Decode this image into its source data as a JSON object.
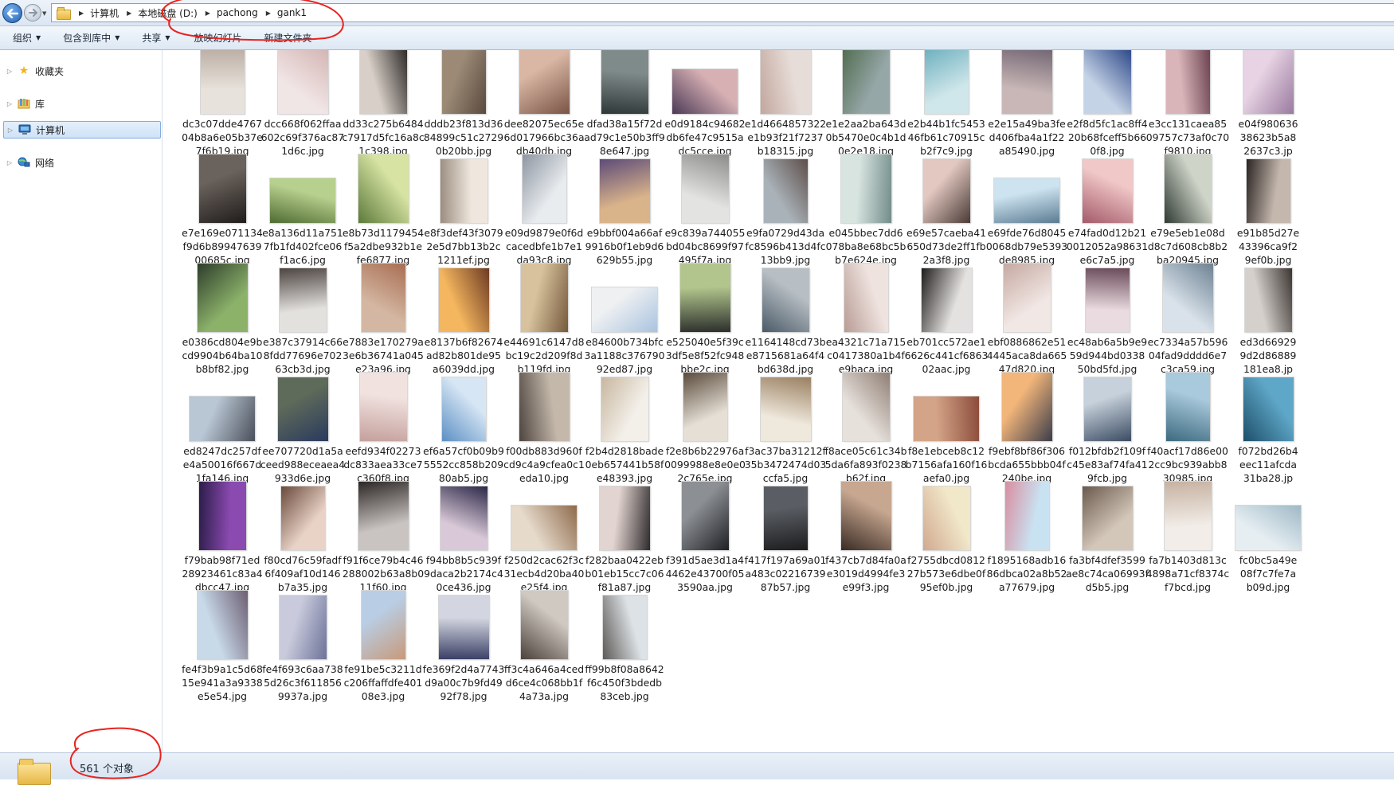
{
  "address_bar": {
    "crumbs": [
      "计算机",
      "本地磁盘 (D:)",
      "pachong",
      "gank1"
    ]
  },
  "toolbar": {
    "organize": "组织",
    "include_in_library": "包含到库中",
    "share": "共享",
    "slideshow": "放映幻灯片",
    "new_folder": "新建文件夹"
  },
  "nav": {
    "favorites": "收藏夹",
    "libraries": "库",
    "computer": "计算机",
    "network": "网络"
  },
  "files": [
    {
      "name": "dc3c07dde4767\n04b8a6e05b37e\n7f6b19.jpg",
      "bg": [
        "#e8e2dc",
        "#b8aaa0"
      ]
    },
    {
      "name": "dcc668f062ffaa\n602c69f376ac87\n1d6c.jpg",
      "bg": [
        "#f1e6e6",
        "#d4b6b4"
      ]
    },
    {
      "name": "dd33c275b6484\nc7917d5fc16a8c\n1c398.jpg",
      "bg": [
        "#d8d0c8",
        "#2a2524"
      ]
    },
    {
      "name": "dddb23f813d36\n84899c51c2729\n0b20bb.jpg",
      "bg": [
        "#9c8a77",
        "#5a4a3d"
      ]
    },
    {
      "name": "dee82075ec65e\n6d017966bc36a\ndb40db.jpg",
      "bg": [
        "#d9b7a4",
        "#7a5446"
      ]
    },
    {
      "name": "dfad38a15f72d\nad79c1e50b3ff9\n8e647.jpg",
      "bg": [
        "#7f8b8a",
        "#2f3838"
      ]
    },
    {
      "name": "e0d9184c94682\ndb6fe47c9515a\ndc5cce.jpg",
      "bg": [
        "#d7b0b4",
        "#4b3a56"
      ]
    },
    {
      "name": "e1d4664857322\ne1b93f21f7237\nb18315.jpg",
      "bg": [
        "#e7ddd8",
        "#c3a79e"
      ]
    },
    {
      "name": "e1e2aa2ba643d\n0b5470e0c4b1d\n0e2e18.jpg",
      "bg": [
        "#96a7a8",
        "#4f6b4e"
      ]
    },
    {
      "name": "e2b44b1fc5453\n46fb61c70915c\nb2f7c9.jpg",
      "bg": [
        "#cfe6ea",
        "#6fb1bf"
      ]
    },
    {
      "name": "e2e15a49ba3fe\nd406fba4a1f22\na85490.jpg",
      "bg": [
        "#c8b7b6",
        "#6c5f6e"
      ]
    },
    {
      "name": "e2f8d5fc1ac8ff4\n20b68fceff5b66\n0f8.jpg",
      "bg": [
        "#c5d3e6",
        "#2f4a8a"
      ]
    },
    {
      "name": "e3cc131caea85\n09757c73af0c70\nf9810.jpg",
      "bg": [
        "#d9b5b9",
        "#6b4251"
      ]
    },
    {
      "name": "e04f980636\n38623b5a8\n2637c3.jp",
      "bg": [
        "#e7d3e3",
        "#9a7aa0"
      ]
    },
    {
      "name": "e7e169e071134\nf9d6b89947639\n00685c.jpg",
      "bg": [
        "#6a625c",
        "#1f1c1b"
      ]
    },
    {
      "name": "e8a136d11a751\n7fb1fd402fce06\nf1ac6.jpg",
      "bg": [
        "#b8d08e",
        "#4f6b32"
      ]
    },
    {
      "name": "e8b73d1179454\nf5a2dbe932b1e\nfe6877.jpg",
      "bg": [
        "#d7e3a2",
        "#5c7a3b"
      ]
    },
    {
      "name": "e8f3def43f3079\n2e5d7bb13b2c\n1211ef.jpg",
      "bg": [
        "#efe7de",
        "#9b8d80"
      ]
    },
    {
      "name": "e09d9879e0f6d\ncacedbfe1b7e1\nda93c8.jpg",
      "bg": [
        "#e9ecef",
        "#8d96a1"
      ]
    },
    {
      "name": "e9bbf004a66af\n9916b0f1eb9d6\n629b55.jpg",
      "bg": [
        "#d9b38a",
        "#5d4b78"
      ]
    },
    {
      "name": "e9c839a744055\nbd04bc8699f97\n495f7a.jpg",
      "bg": [
        "#e3e3e1",
        "#8c8c8a"
      ]
    },
    {
      "name": "e9fa0729d43da\nfc8596b413d4fc\n13bb9.jpg",
      "bg": [
        "#a9b2b8",
        "#5d4e4a"
      ]
    },
    {
      "name": "e045bbec7dd6\n078ba8e68bc5b\nb7e624e.jpg",
      "bg": [
        "#d7e4e0",
        "#728c8a"
      ]
    },
    {
      "name": "e69e57caeba41\n650d73de2ff1fb\n2a3f8.jpg",
      "bg": [
        "#e2c8c0",
        "#4a3a36"
      ]
    },
    {
      "name": "e69fde76d8045\n0068db79e5393\nde8985.jpg",
      "bg": [
        "#cde3f0",
        "#5b7b92"
      ]
    },
    {
      "name": "e74fad0d12b21\n0012052a98631\ne6c7a5.jpg",
      "bg": [
        "#f1c8c8",
        "#a45a6a"
      ]
    },
    {
      "name": "e79e5eb1e08d\nd8c7d608cb8b2\nba20945.jpg",
      "bg": [
        "#cfd4c8",
        "#2f3a33"
      ]
    },
    {
      "name": "e91b85d27e\n43396ca9f2\n9ef0b.jpg",
      "bg": [
        "#c4b7ad",
        "#2b2422"
      ]
    },
    {
      "name": "e0386cd804e9b\ncd9904b64ba10\nb8bf82.jpg",
      "bg": [
        "#8cb26a",
        "#2d3d2b"
      ]
    },
    {
      "name": "e387c37914c66\n8fdd77696e702\n63cb3d.jpg",
      "bg": [
        "#e3e1de",
        "#4d4542"
      ]
    },
    {
      "name": "e7883e170279a\n3e6b36741a045\ne23a96.jpg",
      "bg": [
        "#d4b7a2",
        "#a86e53"
      ]
    },
    {
      "name": "e8137b6f82674\nad82b801de95\na6039dd.jpg",
      "bg": [
        "#f4b65e",
        "#6d3a24"
      ]
    },
    {
      "name": "e44691c6147d8\nbc19c2d209f8d\nb119fd.jpg",
      "bg": [
        "#d8c29d",
        "#75593c"
      ]
    },
    {
      "name": "e84600b734bfc\n3a1188c376790\n92ed87.jpg",
      "bg": [
        "#eef0f2",
        "#a9c3df"
      ]
    },
    {
      "name": "e525040e5f39c\n3df5e8f52fc948\nbbe2c.jpg",
      "bg": [
        "#b2c58c",
        "#2c2f2c"
      ]
    },
    {
      "name": "e1164148cd73b\ne8715681a64f4\nbd638d.jpg",
      "bg": [
        "#b8bfc4",
        "#4b5a68"
      ]
    },
    {
      "name": "ea4321c71a715\nc0417380a1b4f\ne9baca.jpg",
      "bg": [
        "#efe3df",
        "#b89c95"
      ]
    },
    {
      "name": "eb701cc572ae1\n6626c441cf6863\n02aac.jpg",
      "bg": [
        "#e4e2e0",
        "#1f1c1c"
      ]
    },
    {
      "name": "ebf0886862e51\n4445aca8da665\n47d820.jpg",
      "bg": [
        "#f1e7e4",
        "#c6a9a2"
      ]
    },
    {
      "name": "ec48ab6a5b9e9\n59d944bd0338\n50bd5fd.jpg",
      "bg": [
        "#eadbe0",
        "#6a4b5a"
      ]
    },
    {
      "name": "ec7334a57b596\n04fad9dddd6e7\nc3ca59.jpg",
      "bg": [
        "#d9e2ea",
        "#6e8294"
      ]
    },
    {
      "name": "ed3d66929\n9d2d86889\n181ea8.jp",
      "bg": [
        "#d5d0cb",
        "#3b3431"
      ]
    },
    {
      "name": "ed8247dc257df\ne4a50016f667d\n1fa146.jpg",
      "bg": [
        "#b9c6d4",
        "#4a4f5a"
      ]
    },
    {
      "name": "ee707720d1a5a\nceed988eceaea4\n933d6e.jpg",
      "bg": [
        "#5e6a5a",
        "#2a3a5e"
      ]
    },
    {
      "name": "eefd934f02273\ndc833aea33ce7\nc360f8.jpg",
      "bg": [
        "#f1e2e0",
        "#c4a09c"
      ]
    },
    {
      "name": "ef6a57cf0b09b9\n5552cc858b209\n80ab5.jpg",
      "bg": [
        "#d6e6f4",
        "#5c8fc4"
      ]
    },
    {
      "name": "f00db883d960f\ncd9c4a9cfea0c1\neda10.jpg",
      "bg": [
        "#c4b8aa",
        "#4e4540"
      ]
    },
    {
      "name": "f2b4d2818bade\n0eb657441b58f\ne48393.jpg",
      "bg": [
        "#f3efe9",
        "#c7b79f"
      ]
    },
    {
      "name": "f2e8b6b22976a\n0099988e8e0e0\n2c765e.jpg",
      "bg": [
        "#e5dfd6",
        "#5a4b3c"
      ]
    },
    {
      "name": "f3ac37ba31212f\n35b3472474d03\nccfa5.jpg",
      "bg": [
        "#efe8dc",
        "#9a8062"
      ]
    },
    {
      "name": "f8ace05c61c34b\n5da6fa893f0238\nb62f.jpg",
      "bg": [
        "#e7e1dc",
        "#8f7f74"
      ]
    },
    {
      "name": "f8e1ebceb8c12\nb7156afa160f16\naefa0.jpg",
      "bg": [
        "#d4a488",
        "#8b4c3a"
      ]
    },
    {
      "name": "f9ebf8bf86f306\nbcda655bbb04f\n240be.jpg",
      "bg": [
        "#f2b57a",
        "#3c3d4a"
      ]
    },
    {
      "name": "f012bfdb2f109f\nc45e83af74fa41\n9fcb.jpg",
      "bg": [
        "#c7d1db",
        "#3b4c63"
      ]
    },
    {
      "name": "f40acf17d86e00\n2cc9bc939abb8\n30985.jpg",
      "bg": [
        "#a9c9dc",
        "#3d6a7f"
      ]
    },
    {
      "name": "f072bd26b4\neec11afcda\n31ba28.jp",
      "bg": [
        "#5fa7c8",
        "#1d4f6a"
      ]
    },
    {
      "name": "f79bab98f71ed\n28923461c83a4\ndbcc47.jpg",
      "bg": [
        "#8a4ab0",
        "#2c1d4a"
      ]
    },
    {
      "name": "f80cd76c59fadf\n6f409af10d146\nb7a35.jpg",
      "bg": [
        "#e9d3c7",
        "#6a4a3c"
      ]
    },
    {
      "name": "f91f6ce79b4c46\n288002b63a8b0\n11f60.jpg",
      "bg": [
        "#c9c4c2",
        "#2d2626"
      ]
    },
    {
      "name": "f94bb8b5c939f\n9daca2b2174c4\n0ce436.jpg",
      "bg": [
        "#d9c9d8",
        "#2b2747"
      ]
    },
    {
      "name": "f250d2cac62f3c\n31ecb4d20ba40\ne25f4.jpg",
      "bg": [
        "#e6dacb",
        "#8f6b4c"
      ]
    },
    {
      "name": "f282baa0422eb\nb01eb15cc7c06\nf81a87.jpg",
      "bg": [
        "#e2d4d0",
        "#2e2a2c"
      ]
    },
    {
      "name": "f391d5ae3d1a4\n4462e43700f05\n3590aa.jpg",
      "bg": [
        "#8c8f94",
        "#1e2023"
      ]
    },
    {
      "name": "f417f197a69a01\na483c02216739\n87b57.jpg",
      "bg": [
        "#5a5e64",
        "#1c1c1e"
      ]
    },
    {
      "name": "f437cb7d84fa0a\ne3019d4994fe3\ne99f3.jpg",
      "bg": [
        "#c7a790",
        "#3a2b24"
      ]
    },
    {
      "name": "f2755dbcd0812\n27b573e6dbe0f\n95ef0b.jpg",
      "bg": [
        "#f1e7c9",
        "#d1a990"
      ]
    },
    {
      "name": "f1895168adb16\n86dbca02a8b52\na77679.jpg",
      "bg": [
        "#c9e2f2",
        "#d98ea0"
      ]
    },
    {
      "name": "fa3bf4dfef3599\nae8c74ca06993f\nd5b5.jpg",
      "bg": [
        "#d3c7b9",
        "#6a5a4d"
      ]
    },
    {
      "name": "fa7b1403d813c\n4898a71cf8374c\nf7bcd.jpg",
      "bg": [
        "#f2ede8",
        "#c7b2a2"
      ]
    },
    {
      "name": "fc0bc5a49e\n08f7c7fe7a\nb09d.jpg",
      "bg": [
        "#e6eef2",
        "#9fb9c6"
      ]
    },
    {
      "name": "fe4f3b9a1c5d68\n15e941a3a9338\ne5e54.jpg",
      "bg": [
        "#c8d9e8",
        "#6c5e73"
      ]
    },
    {
      "name": "fe4f693c6aa738\n5d26c3f611856\n9937a.jpg",
      "bg": [
        "#c9cbdc",
        "#6d7299"
      ]
    },
    {
      "name": "fe91be5c3211d\nc206ffaffdfe401\n08e3.jpg",
      "bg": [
        "#b9cde4",
        "#c79a7a"
      ]
    },
    {
      "name": "fe369f2d4a7743\nd9a00c7b9fd49\n92f78.jpg",
      "bg": [
        "#d3d6e0",
        "#3a3f66"
      ]
    },
    {
      "name": "ff3c4a646a4ced\nd6ce4c068bb1f\n4a73a.jpg",
      "bg": [
        "#cfc9c2",
        "#4c413a"
      ]
    },
    {
      "name": "ff99b8f08a8642\nf6c450f3bdedb\n83ceb.jpg",
      "bg": [
        "#dde2e6",
        "#5d5a57"
      ]
    }
  ],
  "status": {
    "count": "561 个对象"
  },
  "colors": {
    "annotation_red": "#e8231f",
    "selection_blue": "#cfe2f7"
  }
}
